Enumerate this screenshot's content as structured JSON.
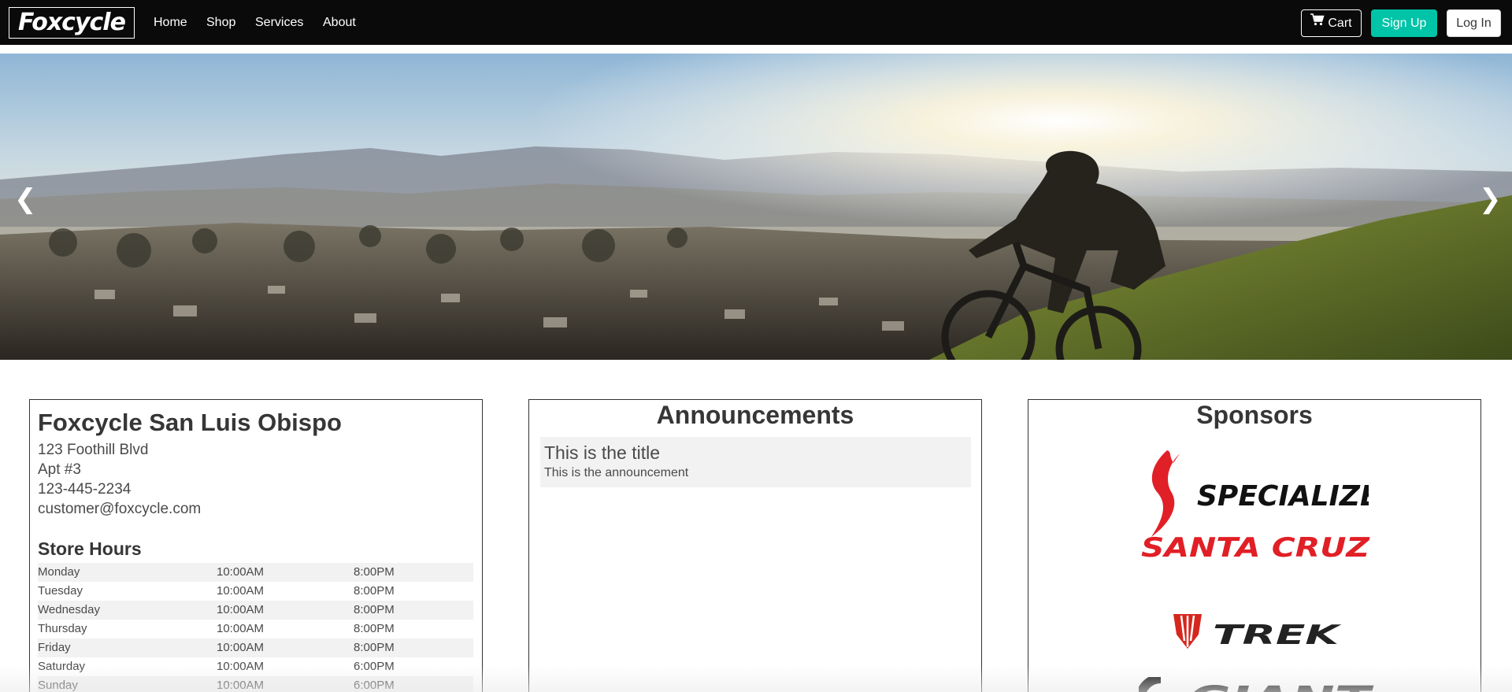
{
  "navbar": {
    "brand": "Foxcycle",
    "links": [
      "Home",
      "Shop",
      "Services",
      "About"
    ],
    "cart_label": "Cart",
    "signup_label": "Sign Up",
    "login_label": "Log In",
    "cart_icon": "shopping-cart-icon",
    "colors": {
      "bar": "#0a0a0a",
      "signup": "#00c4a7"
    }
  },
  "carousel": {
    "prev_symbol": "❮",
    "next_symbol": "❯",
    "slide": "mountain-biker-sunrise-hillside"
  },
  "store": {
    "name": "Foxcycle San Luis Obispo",
    "address_line1": "123 Foothill Blvd",
    "address_line2": "Apt #3",
    "phone": "123-445-2234",
    "email": "customer@foxcycle.com",
    "hours_title": "Store Hours",
    "hours": [
      {
        "day": "Monday",
        "open": "10:00AM",
        "close": "8:00PM"
      },
      {
        "day": "Tuesday",
        "open": "10:00AM",
        "close": "8:00PM"
      },
      {
        "day": "Wednesday",
        "open": "10:00AM",
        "close": "8:00PM"
      },
      {
        "day": "Thursday",
        "open": "10:00AM",
        "close": "8:00PM"
      },
      {
        "day": "Friday",
        "open": "10:00AM",
        "close": "8:00PM"
      },
      {
        "day": "Saturday",
        "open": "10:00AM",
        "close": "6:00PM"
      },
      {
        "day": "Sunday",
        "open": "10:00AM",
        "close": "6:00PM"
      }
    ]
  },
  "announcements": {
    "heading": "Announcements",
    "items": [
      {
        "title": "This is the title",
        "body": "This is the announcement"
      }
    ]
  },
  "sponsors": {
    "heading": "Sponsors",
    "logos": [
      {
        "name": "SPECIALIZED",
        "color": "#e11f26"
      },
      {
        "name": "SANTA CRUZ",
        "color": "#e11f26"
      },
      {
        "name": "TREK",
        "color": "#d6271f"
      },
      {
        "name": "GIANT",
        "color": "#111111"
      }
    ]
  }
}
